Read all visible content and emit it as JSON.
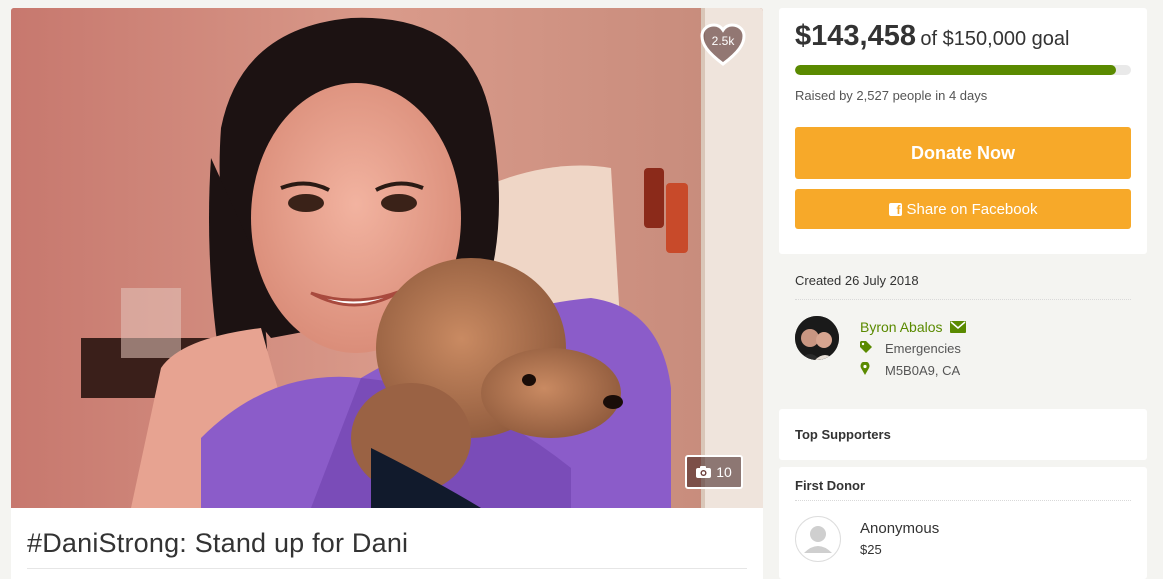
{
  "campaign": {
    "title": "#DaniStrong: Stand up for Dani",
    "hearts_label": "2.5k",
    "photo_count": "10"
  },
  "donation": {
    "amount": "$143,458",
    "goal_text": "of $150,000 goal",
    "progress_percent": 95.6,
    "raised_text": "Raised by 2,527 people in 4 days",
    "donate_label": "Donate Now",
    "share_label": "Share on Facebook"
  },
  "meta": {
    "created": "Created 26 July 2018",
    "organizer": "Byron Abalos",
    "category": "Emergencies",
    "location": "M5B0A9, CA"
  },
  "top_supporters": {
    "heading": "Top Supporters"
  },
  "first_donor": {
    "heading": "First Donor",
    "name": "Anonymous",
    "amount": "$25"
  },
  "colors": {
    "accent_green": "#5a8a00",
    "button_orange": "#f7a929"
  },
  "icons": [
    "heart-icon",
    "camera-icon",
    "facebook-icon",
    "envelope-icon",
    "tag-icon",
    "map-pin-icon",
    "user-icon"
  ]
}
